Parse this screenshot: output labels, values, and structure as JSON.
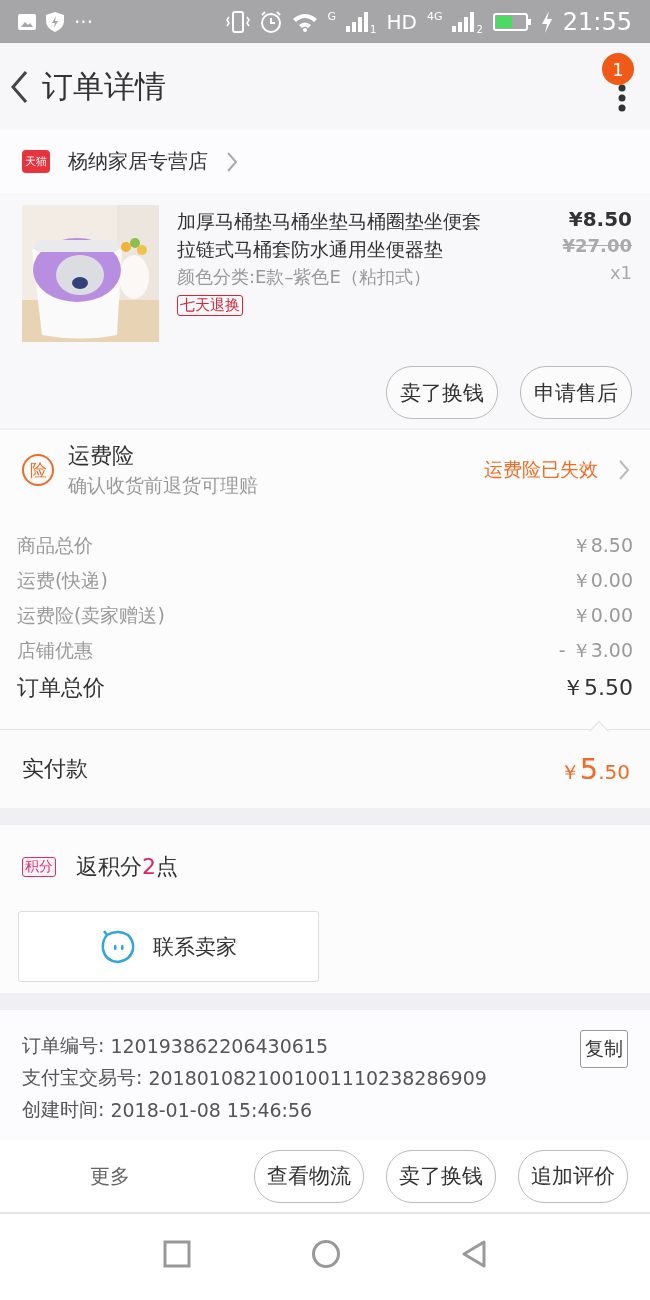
{
  "status_bar": {
    "more": "···",
    "signal_1_type": "G",
    "sim_1": "1",
    "hd": "HD",
    "signal_2_type": "4G",
    "sim_2": "2",
    "time": "21:55"
  },
  "header": {
    "title": "订单详情",
    "badge": "1"
  },
  "store": {
    "badge": "天猫",
    "name": "杨纳家居专营店"
  },
  "item": {
    "title": "加厚马桶垫马桶坐垫马桶圈垫坐便套拉链式马桶套防水通用坐便器垫",
    "variant": "颜色分类:E款–紫色E（粘扣式）",
    "tag": "七天退换",
    "price": "¥8.50",
    "original_price": "¥27.00",
    "quantity": "x1",
    "buttons": [
      "卖了换钱",
      "申请售后"
    ]
  },
  "insurance": {
    "icon_label": "险",
    "title": "运费险",
    "subtitle": "确认收货前退货可理赔",
    "status": "运费险已失效"
  },
  "price_rows": [
    {
      "kind": "line",
      "label": "商品总价",
      "value": "￥8.50"
    },
    {
      "kind": "line",
      "label": "运费(快递)",
      "value": "￥0.00"
    },
    {
      "kind": "line",
      "label": "运费险(卖家赠送)",
      "value": "￥0.00"
    },
    {
      "kind": "line",
      "label": "店铺优惠",
      "value": "- ￥3.00"
    },
    {
      "kind": "total",
      "label": "订单总价",
      "value": "￥5.50"
    }
  ],
  "paid": {
    "label": "实付款",
    "currency": "￥",
    "integer": "5",
    "decimal": ".50"
  },
  "points": {
    "badge": "积分",
    "prefix": "返积分",
    "value": "2",
    "suffix": "点"
  },
  "contact_button": "联系卖家",
  "order_info": {
    "copy_button": "复制",
    "rows": [
      {
        "label": "订单编号:",
        "value": "120193862206430615"
      },
      {
        "label": "支付宝交易号:",
        "value": "2018010821001001110238286909"
      },
      {
        "label": "创建时间:",
        "value": "2018-01-08 15:46:56"
      }
    ]
  },
  "action_bar": {
    "more": "更多",
    "buttons": [
      "查看物流",
      "卖了换钱",
      "追加评价"
    ]
  }
}
